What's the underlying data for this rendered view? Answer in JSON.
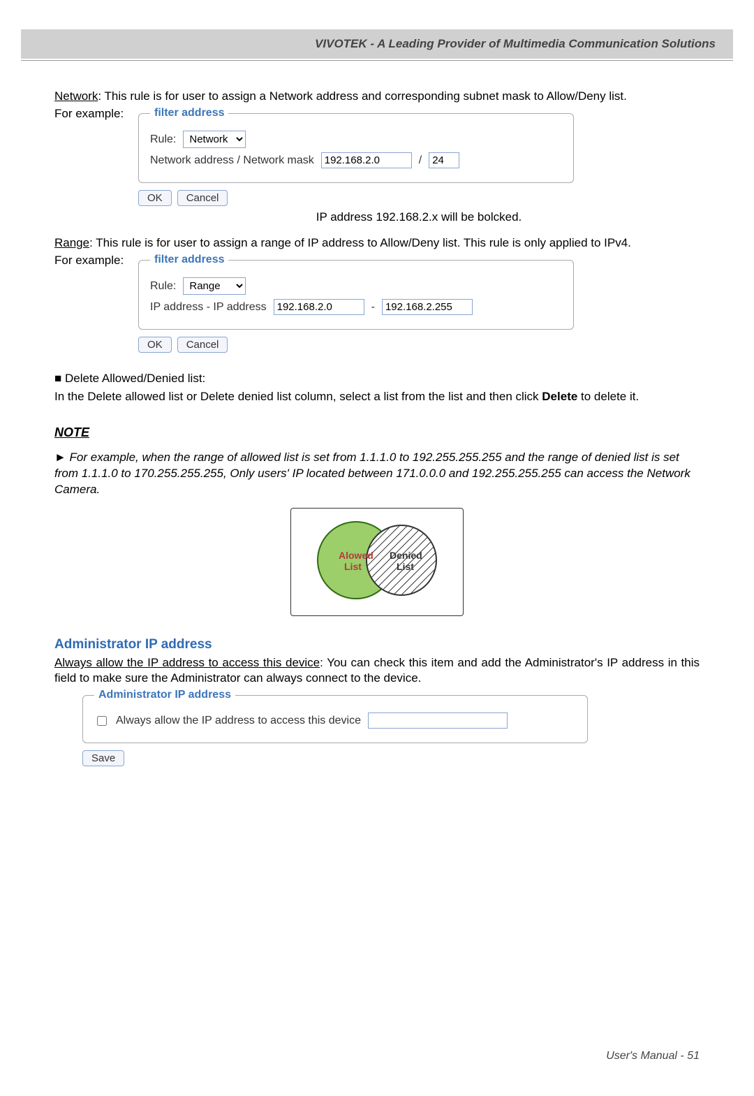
{
  "header": "VIVOTEK - A Leading Provider of Multimedia Communication Solutions",
  "network_intro_u": "Network",
  "network_intro_rest": ": This rule is for user to assign a Network address and corresponding subnet mask to Allow/Deny list.",
  "for_example": "For example:",
  "filter_legend": "filter address",
  "rule_label": "Rule:",
  "rule_network_option": "Network",
  "rule_range_option": "Range",
  "net_field_label": "Network address / Network mask",
  "net_ip": "192.168.2.0",
  "net_slash": "/",
  "net_mask": "24",
  "btn_ok": "OK",
  "btn_cancel": "Cancel",
  "ip_blocked_note": "IP address 192.168.2.x will be bolcked.",
  "range_intro_u": "Range",
  "range_intro_rest": ": This rule is for user to assign a range of IP address to Allow/Deny list. This rule is only applied to IPv4.",
  "range_field_label": "IP address - IP address",
  "range_ip1": "192.168.2.0",
  "range_sep": "-",
  "range_ip2": "192.168.2.255",
  "delete_head": "■ Delete Allowed/Denied list:",
  "delete_body_1": "In the Delete allowed list or Delete denied list column, select a list from the list and then click ",
  "delete_bold": "Delete",
  "delete_body_2": " to delete it.",
  "note_heading": "NOTE",
  "note_body": "► For example, when the range of allowed list is set from 1.1.1.0 to 192.255.255.255 and the range of denied list is set from 1.1.1.0 to 170.255.255.255, Only users' IP located between 171.0.0.0 and 192.255.255.255 can access the Network Camera.",
  "venn_allowed": "Alowed",
  "venn_list": "List",
  "venn_denied": "Denied",
  "admin_heading": "Administrator IP address",
  "admin_intro_u": "Always allow the IP address to access this device",
  "admin_intro_rest": ": You can check this item and add the Administrator's IP address in this field to make sure the Administrator can always connect to the device.",
  "admin_legend": "Administrator IP address",
  "admin_chk_label": "Always allow the IP address to access this device",
  "admin_ip": "",
  "btn_save": "Save",
  "footer": "User's Manual - 51"
}
